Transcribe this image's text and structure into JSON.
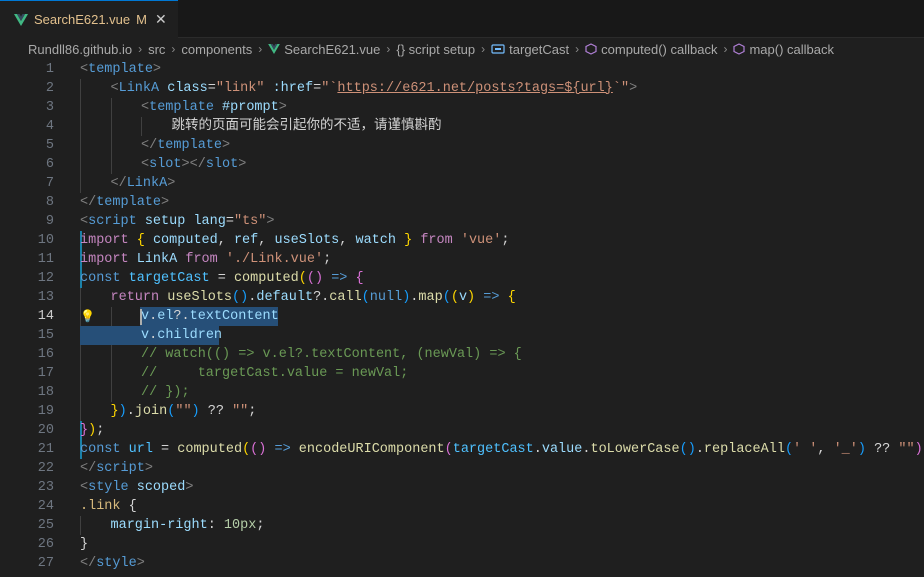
{
  "tab": {
    "filename": "SearchE621.vue",
    "status": "M",
    "close": "✕"
  },
  "breadcrumb": [
    "Rundll86.github.io",
    "src",
    "components",
    "SearchE621.vue",
    "{} script setup",
    "targetCast",
    "computed() callback",
    "map() callback"
  ],
  "lines": [
    {
      "n": "1",
      "t": [
        [
          "tg",
          "<"
        ],
        [
          "tn",
          "template"
        ],
        [
          "tg",
          ">"
        ]
      ]
    },
    {
      "n": "2",
      "t": [
        [
          "tg",
          "<"
        ],
        [
          "tn",
          "LinkA"
        ],
        [
          "pl",
          " "
        ],
        [
          "at",
          "class"
        ],
        [
          "pl",
          "="
        ],
        [
          "st",
          "\"link\""
        ],
        [
          "pl",
          " "
        ],
        [
          "at",
          ":href"
        ],
        [
          "pl",
          "="
        ],
        [
          "st",
          "\"`"
        ],
        [
          "url",
          "https://e621.net/posts?tags=${url}"
        ],
        [
          "st",
          "`\""
        ],
        [
          "tg",
          ">"
        ]
      ]
    },
    {
      "n": "3",
      "t": [
        [
          "tg",
          "<"
        ],
        [
          "tn",
          "template"
        ],
        [
          "pl",
          " "
        ],
        [
          "at",
          "#prompt"
        ],
        [
          "tg",
          ">"
        ]
      ]
    },
    {
      "n": "4",
      "t": [
        [
          "tx",
          "跳转的页面可能会引起你的不适，请谨慎斟酌"
        ]
      ]
    },
    {
      "n": "5",
      "t": [
        [
          "tg",
          "</"
        ],
        [
          "tn",
          "template"
        ],
        [
          "tg",
          ">"
        ]
      ]
    },
    {
      "n": "6",
      "t": [
        [
          "tg",
          "<"
        ],
        [
          "tn",
          "slot"
        ],
        [
          "tg",
          "></"
        ],
        [
          "tn",
          "slot"
        ],
        [
          "tg",
          ">"
        ]
      ]
    },
    {
      "n": "7",
      "t": [
        [
          "tg",
          "</"
        ],
        [
          "tn",
          "LinkA"
        ],
        [
          "tg",
          ">"
        ]
      ]
    },
    {
      "n": "8",
      "t": [
        [
          "tg",
          "</"
        ],
        [
          "tn",
          "template"
        ],
        [
          "tg",
          ">"
        ]
      ]
    },
    {
      "n": "9",
      "t": [
        [
          "tg",
          "<"
        ],
        [
          "tn",
          "script"
        ],
        [
          "pl",
          " "
        ],
        [
          "at",
          "setup"
        ],
        [
          "pl",
          " "
        ],
        [
          "at",
          "lang"
        ],
        [
          "pl",
          "="
        ],
        [
          "st",
          "\"ts\""
        ],
        [
          "tg",
          ">"
        ]
      ]
    },
    {
      "n": "10",
      "t": [
        [
          "kw",
          "import"
        ],
        [
          "pl",
          " "
        ],
        [
          "b1",
          "{"
        ],
        [
          "pl",
          " "
        ],
        [
          "vr",
          "computed"
        ],
        [
          "pl",
          ", "
        ],
        [
          "vr",
          "ref"
        ],
        [
          "pl",
          ", "
        ],
        [
          "vr",
          "useSlots"
        ],
        [
          "pl",
          ", "
        ],
        [
          "vr",
          "watch"
        ],
        [
          "pl",
          " "
        ],
        [
          "b1",
          "}"
        ],
        [
          "pl",
          " "
        ],
        [
          "kw",
          "from"
        ],
        [
          "pl",
          " "
        ],
        [
          "st",
          "'vue'"
        ],
        [
          "pl",
          ";"
        ]
      ]
    },
    {
      "n": "11",
      "t": [
        [
          "kw",
          "import"
        ],
        [
          "pl",
          " "
        ],
        [
          "vr",
          "LinkA"
        ],
        [
          "pl",
          " "
        ],
        [
          "kw",
          "from"
        ],
        [
          "pl",
          " "
        ],
        [
          "st",
          "'./Link.vue'"
        ],
        [
          "pl",
          ";"
        ]
      ]
    },
    {
      "n": "12",
      "t": [
        [
          "kb",
          "const"
        ],
        [
          "pl",
          " "
        ],
        [
          "cn",
          "targetCast"
        ],
        [
          "pl",
          " = "
        ],
        [
          "fn",
          "computed"
        ],
        [
          "b1",
          "("
        ],
        [
          "b2",
          "()"
        ],
        [
          "pl",
          " "
        ],
        [
          "kb",
          "=>"
        ],
        [
          "pl",
          " "
        ],
        [
          "b2",
          "{"
        ]
      ]
    },
    {
      "n": "13",
      "t": [
        [
          "kw",
          "return"
        ],
        [
          "pl",
          " "
        ],
        [
          "fn",
          "useSlots"
        ],
        [
          "b3",
          "()"
        ],
        [
          "pl",
          "."
        ],
        [
          "vr",
          "default"
        ],
        [
          "pl",
          "?."
        ],
        [
          "fn",
          "call"
        ],
        [
          "b3",
          "("
        ],
        [
          "kb",
          "null"
        ],
        [
          "b3",
          ")"
        ],
        [
          "pl",
          "."
        ],
        [
          "fn",
          "map"
        ],
        [
          "b3",
          "("
        ],
        [
          "b1",
          "("
        ],
        [
          "vr",
          "v"
        ],
        [
          "b1",
          ")"
        ],
        [
          "pl",
          " "
        ],
        [
          "kb",
          "=>"
        ],
        [
          "pl",
          " "
        ],
        [
          "b1",
          "{"
        ]
      ]
    },
    {
      "n": "14",
      "t": [
        [
          "vr",
          "v"
        ],
        [
          "pl",
          "."
        ],
        [
          "vr",
          "el"
        ],
        [
          "pl",
          "?."
        ],
        [
          "vr",
          "textContent"
        ]
      ]
    },
    {
      "n": "15",
      "t": [
        [
          "vr",
          "v"
        ],
        [
          "pl",
          "."
        ],
        [
          "vr",
          "children"
        ]
      ]
    },
    {
      "n": "16",
      "t": [
        [
          "cm",
          "// watch(() => v.el?.textContent, (newVal) => {"
        ]
      ]
    },
    {
      "n": "17",
      "t": [
        [
          "cm",
          "//     targetCast.value = newVal;"
        ]
      ]
    },
    {
      "n": "18",
      "t": [
        [
          "cm",
          "// });"
        ]
      ]
    },
    {
      "n": "19",
      "t": [
        [
          "b1",
          "}"
        ],
        [
          "b3",
          ")"
        ],
        [
          "pl",
          "."
        ],
        [
          "fn",
          "join"
        ],
        [
          "b3",
          "("
        ],
        [
          "st",
          "\"\""
        ],
        [
          "b3",
          ")"
        ],
        [
          "pl",
          " ?? "
        ],
        [
          "st",
          "\"\""
        ],
        [
          "pl",
          ";"
        ]
      ]
    },
    {
      "n": "20",
      "t": [
        [
          "b2",
          "}"
        ],
        [
          "b1",
          ")"
        ],
        [
          "pl",
          ";"
        ]
      ]
    },
    {
      "n": "21",
      "t": [
        [
          "kb",
          "const"
        ],
        [
          "pl",
          " "
        ],
        [
          "cn",
          "url"
        ],
        [
          "pl",
          " = "
        ],
        [
          "fn",
          "computed"
        ],
        [
          "b1",
          "("
        ],
        [
          "b2",
          "()"
        ],
        [
          "pl",
          " "
        ],
        [
          "kb",
          "=>"
        ],
        [
          "pl",
          " "
        ],
        [
          "fn",
          "encodeURIComponent"
        ],
        [
          "b2",
          "("
        ],
        [
          "cn",
          "targetCast"
        ],
        [
          "pl",
          "."
        ],
        [
          "vr",
          "value"
        ],
        [
          "pl",
          "."
        ],
        [
          "fn",
          "toLowerCase"
        ],
        [
          "b3",
          "()"
        ],
        [
          "pl",
          "."
        ],
        [
          "fn",
          "replaceAll"
        ],
        [
          "b3",
          "("
        ],
        [
          "st",
          "' '"
        ],
        [
          "pl",
          ", "
        ],
        [
          "st",
          "'_'"
        ],
        [
          "b3",
          ")"
        ],
        [
          "pl",
          " ?? "
        ],
        [
          "st",
          "\"\""
        ],
        [
          "b2",
          ")"
        ],
        [
          "b1",
          ")"
        ],
        [
          "pl",
          ";"
        ]
      ]
    },
    {
      "n": "22",
      "t": [
        [
          "tg",
          "</"
        ],
        [
          "tn",
          "script"
        ],
        [
          "tg",
          ">"
        ]
      ]
    },
    {
      "n": "23",
      "t": [
        [
          "tg",
          "<"
        ],
        [
          "tn",
          "style"
        ],
        [
          "pl",
          " "
        ],
        [
          "at",
          "scoped"
        ],
        [
          "tg",
          ">"
        ]
      ]
    },
    {
      "n": "24",
      "t": [
        [
          "cls",
          ".link"
        ],
        [
          "pl",
          " {"
        ]
      ]
    },
    {
      "n": "25",
      "t": [
        [
          "at",
          "margin-right"
        ],
        [
          "pl",
          ": "
        ],
        [
          "nm",
          "10px"
        ],
        [
          "pl",
          ";"
        ]
      ]
    },
    {
      "n": "26",
      "t": [
        [
          "pl",
          "}"
        ]
      ]
    },
    {
      "n": "27",
      "t": [
        [
          "tg",
          "</"
        ],
        [
          "tn",
          "style"
        ],
        [
          "tg",
          ">"
        ]
      ]
    }
  ]
}
